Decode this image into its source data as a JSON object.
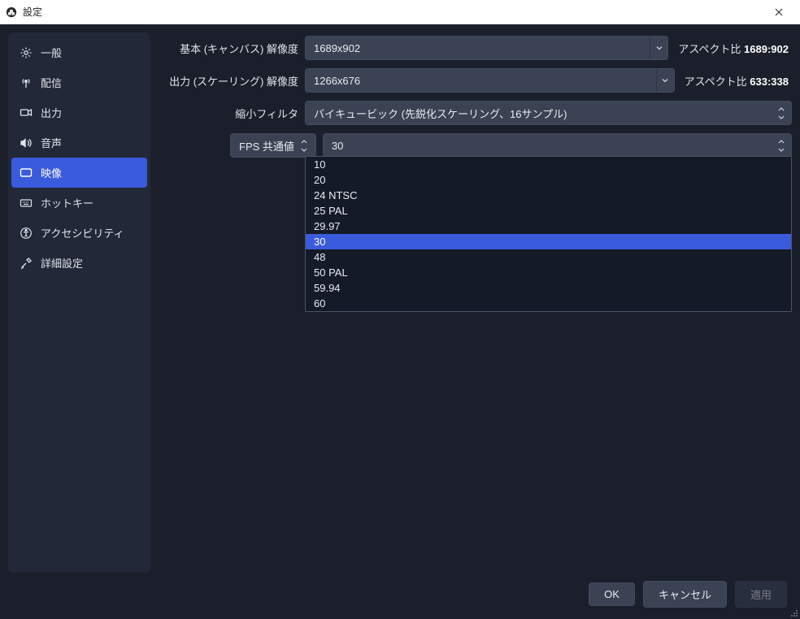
{
  "window": {
    "title": "設定"
  },
  "sidebar": {
    "items": [
      {
        "label": "一般"
      },
      {
        "label": "配信"
      },
      {
        "label": "出力"
      },
      {
        "label": "音声"
      },
      {
        "label": "映像"
      },
      {
        "label": "ホットキー"
      },
      {
        "label": "アクセシビリティ"
      },
      {
        "label": "詳細設定"
      }
    ]
  },
  "video": {
    "base_label": "基本 (キャンバス) 解像度",
    "base_value": "1689x902",
    "base_aspect_label": "アスペクト比",
    "base_aspect_value": "1689:902",
    "output_label": "出力 (スケーリング) 解像度",
    "output_value": "1266x676",
    "output_aspect_label": "アスペクト比",
    "output_aspect_value": "633:338",
    "filter_label": "縮小フィルタ",
    "filter_value": "バイキュービック (先鋭化スケーリング、16サンプル)",
    "fps_type_label": "FPS 共通値",
    "fps_value": "30",
    "fps_options": [
      "10",
      "20",
      "24 NTSC",
      "25 PAL",
      "29.97",
      "30",
      "48",
      "50 PAL",
      "59.94",
      "60"
    ],
    "fps_selected_index": 5
  },
  "footer": {
    "ok": "OK",
    "cancel": "キャンセル",
    "apply": "適用"
  }
}
